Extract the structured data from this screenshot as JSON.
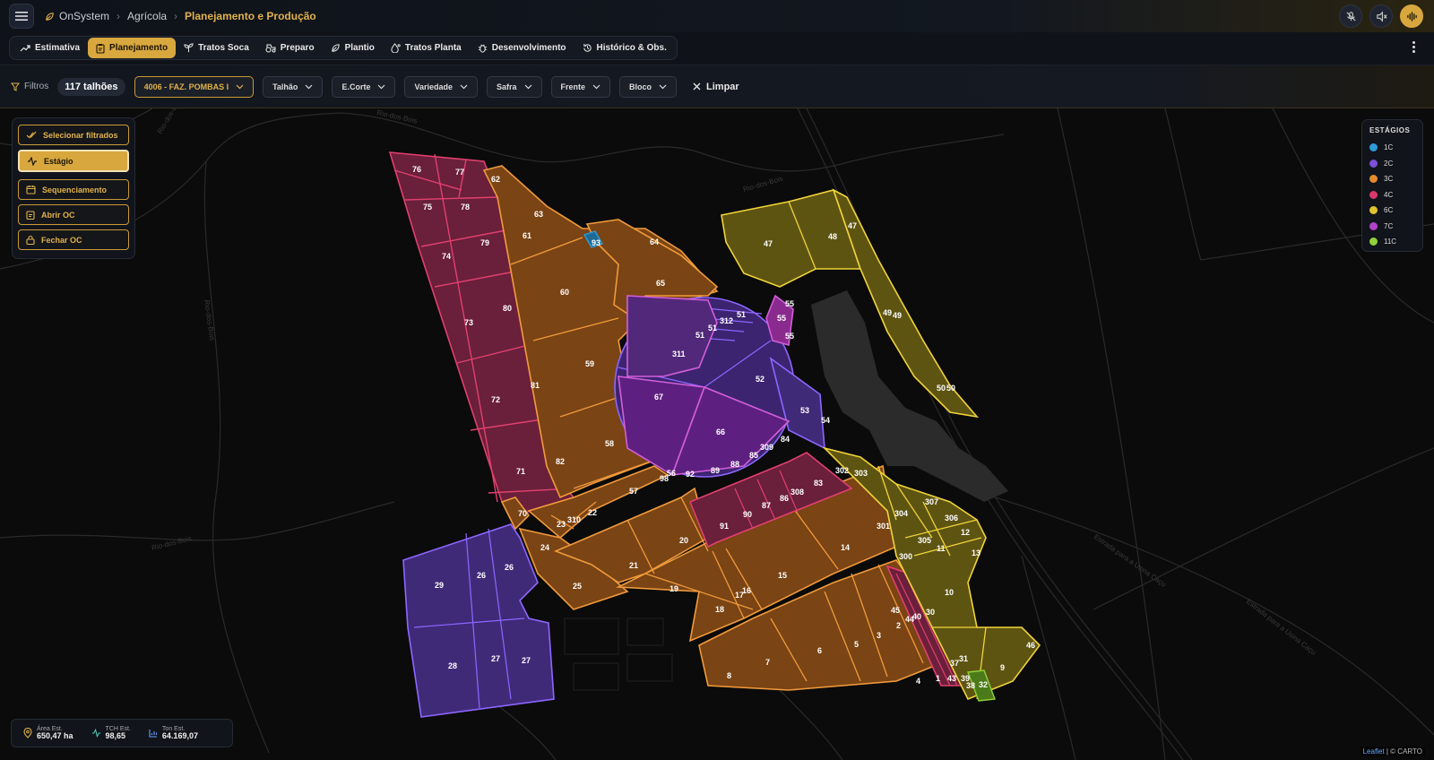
{
  "header": {
    "breadcrumb": [
      "OnSystem",
      "Agrícola",
      "Planejamento e Produção"
    ],
    "icons": [
      "menu-icon",
      "mic-off-icon",
      "volume-off-icon",
      "audio-wave-icon"
    ]
  },
  "tabs": [
    {
      "label": "Estimativa",
      "icon": "trend-icon",
      "active": false
    },
    {
      "label": "Planejamento",
      "icon": "clipboard-icon",
      "active": true
    },
    {
      "label": "Tratos Soca",
      "icon": "sprout-icon",
      "active": false
    },
    {
      "label": "Preparo",
      "icon": "tractor-icon",
      "active": false
    },
    {
      "label": "Plantio",
      "icon": "leaf-icon",
      "active": false
    },
    {
      "label": "Tratos Planta",
      "icon": "drop-icon",
      "active": false
    },
    {
      "label": "Desenvolvimento",
      "icon": "bug-icon",
      "active": false
    },
    {
      "label": "Histórico & Obs.",
      "icon": "history-icon",
      "active": false
    }
  ],
  "filters": {
    "label": "Filtros",
    "count": "117 talhões",
    "fazenda": "4006 - FAZ. POMBAS I",
    "selects": [
      "Talhão",
      "E.Corte",
      "Variedade",
      "Safra",
      "Frente",
      "Bloco"
    ],
    "clear": "Limpar"
  },
  "tools": [
    "Selecionar filtrados",
    "Estágio",
    "Sequenciamento",
    "Abrir OC",
    "Fechar OC"
  ],
  "legend": {
    "title": "ESTÁGIOS",
    "items": [
      {
        "label": "1C",
        "color": "#2e9bd6"
      },
      {
        "label": "2C",
        "color": "#7b4fd6"
      },
      {
        "label": "3C",
        "color": "#e58a2e"
      },
      {
        "label": "4C",
        "color": "#d8396a"
      },
      {
        "label": "6C",
        "color": "#e0c22e"
      },
      {
        "label": "7C",
        "color": "#b043c8"
      },
      {
        "label": "11C",
        "color": "#8fd13a"
      }
    ]
  },
  "stats": [
    {
      "label": "Área Est.",
      "value": "650,47 ha",
      "icon": "pin-icon"
    },
    {
      "label": "TCH Est.",
      "value": "98,65",
      "icon": "pulse-icon"
    },
    {
      "label": "Ton Est.",
      "value": "64.169,07",
      "icon": "bar-chart-icon"
    }
  ],
  "road_labels": [
    "Rio-dos-Bois",
    "Rio-dos-Bois",
    "Rio-dos-Bois",
    "Rio-dos-Bois",
    "Rio-dos-Bois",
    "Estrada para a Usina Caçu",
    "Estrada para a Usina Caçu"
  ],
  "attribution": {
    "leaflet": "Leaflet",
    "sep": "|",
    "carto": "© CARTO"
  },
  "plot_labels": [
    "76",
    "77",
    "62",
    "75",
    "78",
    "63",
    "61",
    "93",
    "64",
    "74",
    "79",
    "65",
    "60",
    "55",
    "55",
    "55",
    "73",
    "80",
    "51",
    "312",
    "51",
    "51",
    "311",
    "59",
    "52",
    "72",
    "81",
    "67",
    "53",
    "54",
    "66",
    "58",
    "84",
    "309",
    "85",
    "71",
    "82",
    "89",
    "88",
    "92",
    "56",
    "98",
    "57",
    "83",
    "308",
    "86",
    "87",
    "90",
    "91",
    "70",
    "23",
    "310",
    "22",
    "24",
    "20",
    "14",
    "21",
    "15",
    "25",
    "19",
    "17",
    "16",
    "18",
    "26",
    "26",
    "29",
    "28",
    "27",
    "27",
    "8",
    "7",
    "6",
    "5",
    "3",
    "45",
    "2",
    "4",
    "1",
    "47",
    "48",
    "47",
    "49",
    "49",
    "50",
    "50",
    "302",
    "303",
    "304",
    "307",
    "306",
    "301",
    "305",
    "12",
    "11",
    "13",
    "300",
    "10",
    "31",
    "37",
    "43",
    "39",
    "38",
    "32",
    "9",
    "46",
    "40",
    "30",
    "44"
  ]
}
